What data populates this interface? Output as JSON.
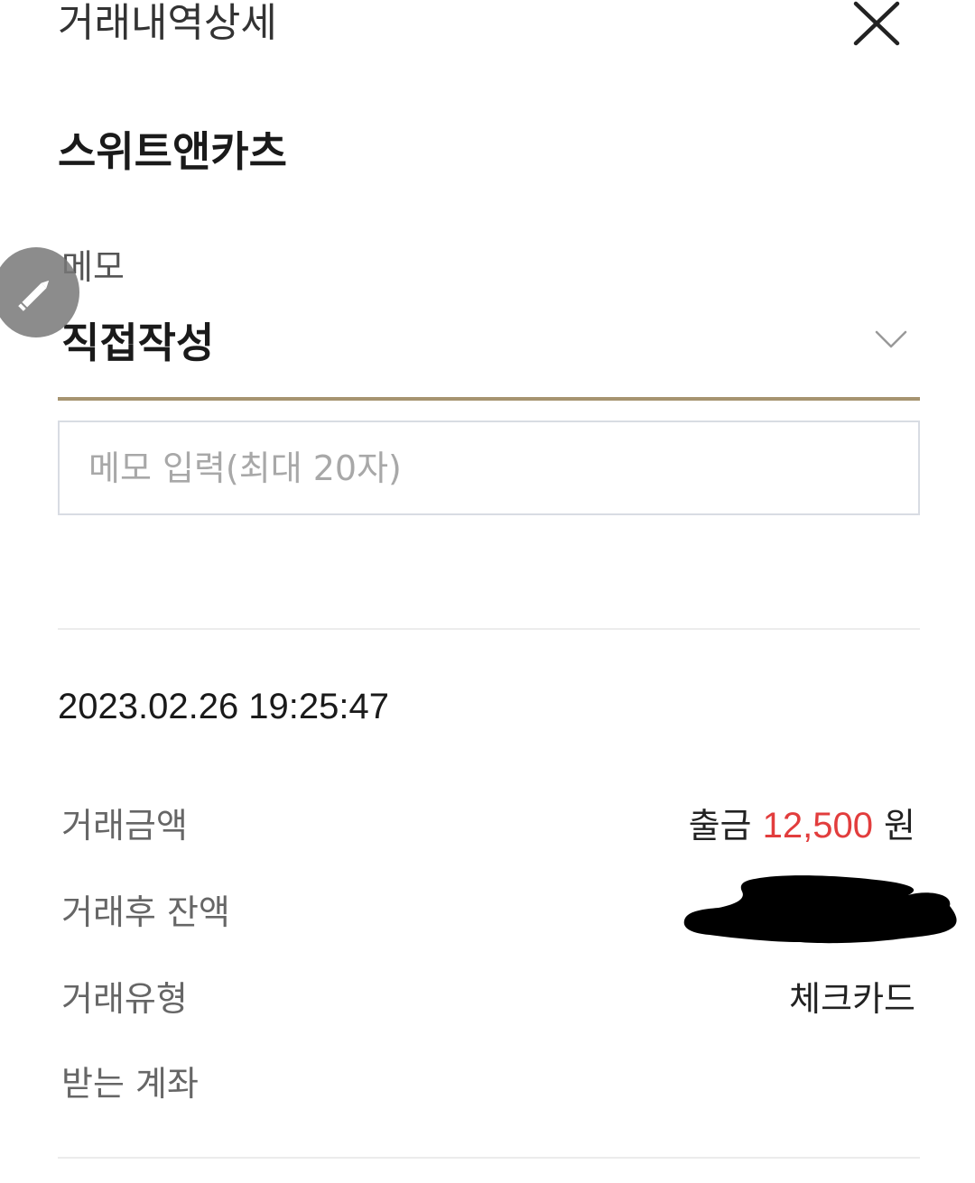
{
  "header": {
    "title": "거래내역상세"
  },
  "merchant": {
    "name": "스위트앤카츠"
  },
  "memo": {
    "label": "메모",
    "selected": "직접작성",
    "input_placeholder": "메모 입력(최대 20자)",
    "input_value": ""
  },
  "transaction": {
    "datetime": "2023.02.26 19:25:47",
    "rows": {
      "amount": {
        "label": "거래금액",
        "direction": "출금",
        "value": "12,500",
        "unit": "원"
      },
      "balance": {
        "label": "거래후 잔액",
        "value": ""
      },
      "type": {
        "label": "거래유형",
        "value": "체크카드"
      },
      "account": {
        "label": "받는 계좌",
        "value": ""
      }
    }
  },
  "colors": {
    "accent_underline": "#a69470",
    "amount_red": "#e23d3d",
    "fab_gray": "#787878"
  },
  "icons": {
    "close": "close-icon",
    "edit": "pencil-icon",
    "dropdown": "chevron-down-icon"
  }
}
